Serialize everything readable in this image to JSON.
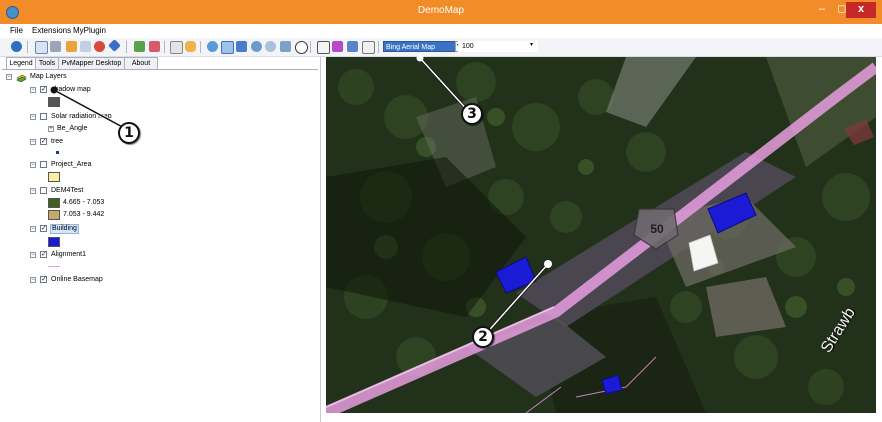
{
  "window": {
    "title": "DemoMap",
    "minimize_glyph": "–",
    "maximize_glyph": "◻",
    "close_glyph": "x"
  },
  "menu": {
    "items": [
      "File",
      "Extensions",
      "MyPlugin"
    ]
  },
  "toolbar": {
    "map_source_value": "Bing Aerial Map",
    "zoom_value": "100",
    "dropdown_glyph": "▾"
  },
  "panel": {
    "tabs": [
      "Legend",
      "Tools",
      "PvMapper Desktop",
      "About"
    ],
    "root_label": "Map Layers",
    "layers": [
      {
        "label": "shadow map",
        "checked": true,
        "legend_color": "#555555"
      },
      {
        "label": "Solar radiation map",
        "checked": false,
        "sublabel": "Be_Angle"
      },
      {
        "label": "tree",
        "checked": true,
        "legend_color": "#1a3a8c"
      },
      {
        "label": "Project_Area",
        "checked": false,
        "legend_color": "#fbeea5"
      },
      {
        "label": "DEM4Test",
        "checked": false,
        "classes": [
          {
            "label": "4.665 - 7.053",
            "color": "#3f5f1f"
          },
          {
            "label": "7.053 - 9.442",
            "color": "#c9a76a"
          }
        ]
      },
      {
        "label": "Building",
        "checked": true,
        "legend_color": "#1b1bd6"
      },
      {
        "label": "Alignment1",
        "checked": true,
        "legend_color": "#e79de0"
      },
      {
        "label": "Online Basemap",
        "checked": true
      }
    ],
    "check_glyph": "✓",
    "collapse_glyph": "−",
    "expand_glyph": "+"
  },
  "map": {
    "route_shield_text": "50",
    "street_text": "Strawb"
  },
  "callouts": [
    "1",
    "2",
    "3"
  ],
  "colors": {
    "titlebar": "#f28c28",
    "selected_dropdown": "#3b73c4",
    "building": "#1b1bd6",
    "alignment": "#e79de0",
    "close_button": "#c62828"
  }
}
